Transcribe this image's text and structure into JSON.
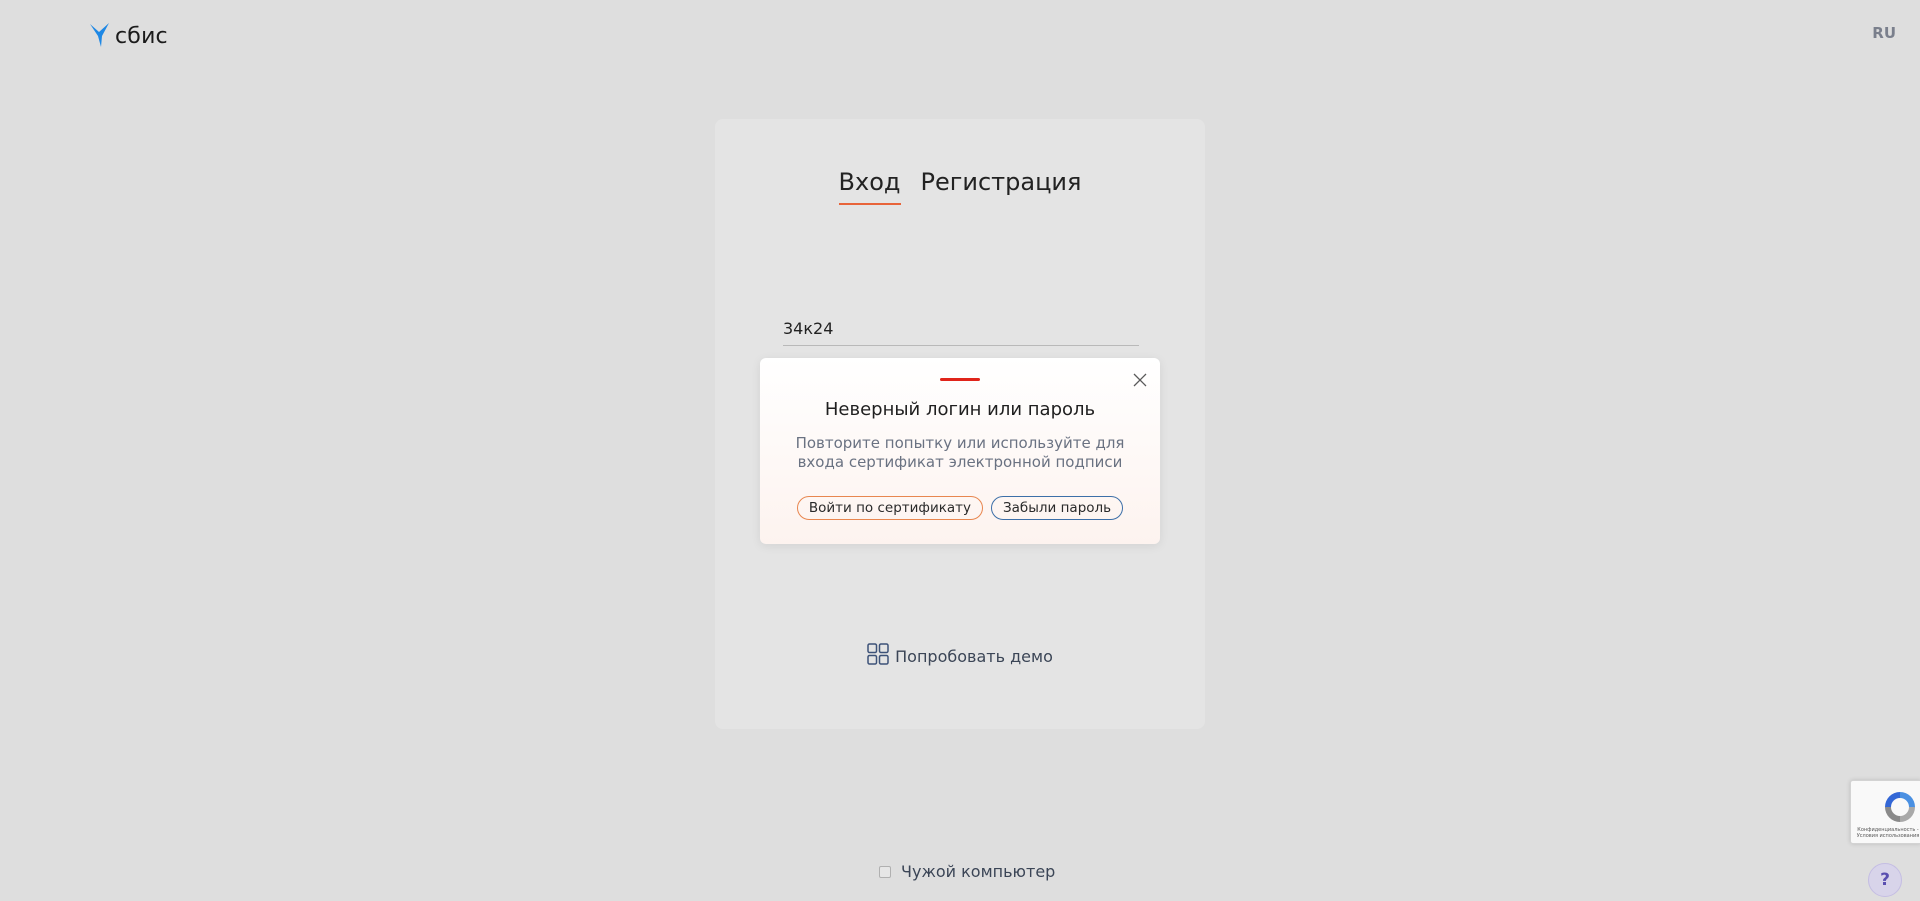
{
  "header": {
    "logo_text": "сбис",
    "lang_label": "RU"
  },
  "card": {
    "tabs": [
      {
        "label": "Вход",
        "active": true
      },
      {
        "label": "Регистрация",
        "active": false
      }
    ],
    "login": {
      "value": "34к24"
    },
    "demo_label": "Попробовать демо"
  },
  "error_popup": {
    "title": "Неверный логин или пароль",
    "text": "Повторите попытку или используйте для входа сертификат электронной подписи",
    "cert_button": "Войти по сертификату",
    "forgot_button": "Забыли пароль"
  },
  "footer": {
    "foreign_computer_label": "Чужой компьютер"
  },
  "recaptcha": {
    "text": "Конфиденциальность - Условия использования"
  },
  "help": {
    "label": "?"
  },
  "colors": {
    "background": "#dedede",
    "card": "#e4e4e4",
    "accent_orange": "#e8643a",
    "error_red": "#e0241a",
    "link_blue": "#3d6fa8",
    "logo_blue": "#1e88e5"
  },
  "icons": [
    "sbis-bird-icon",
    "close-icon",
    "demo-grid-icon",
    "recaptcha-icon"
  ]
}
